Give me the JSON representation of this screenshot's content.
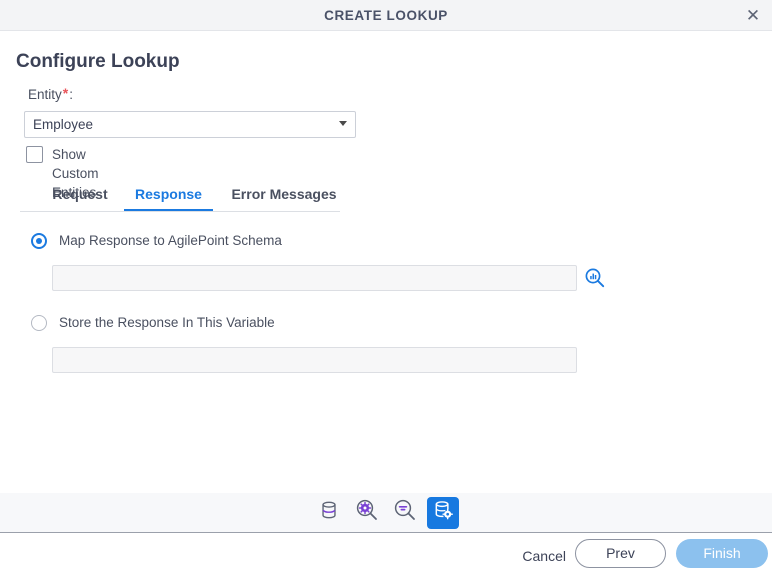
{
  "window": {
    "title": "CREATE LOOKUP",
    "close_icon": "close-icon",
    "close_glyph": "✕"
  },
  "form": {
    "heading": "Configure Lookup",
    "entity": {
      "label": "Entity",
      "required_marker": "*",
      "colon": ":",
      "selected": "Employee",
      "options": [
        "Employee"
      ]
    },
    "show_custom_entities": {
      "label": "Show Custom Entities",
      "checked": false
    }
  },
  "tabs": [
    {
      "label": "Request",
      "active": false
    },
    {
      "label": "Response",
      "active": true
    },
    {
      "label": "Error Messages",
      "active": false
    }
  ],
  "response_tab": {
    "option_map": {
      "label": "Map Response to AgilePoint Schema",
      "selected": true,
      "input_value": "",
      "input_placeholder": "",
      "lookup_icon": "schema-search-icon"
    },
    "option_store": {
      "label": "Store the Response In This Variable",
      "selected": false,
      "input_value": "",
      "input_placeholder": ""
    }
  },
  "toolbar": {
    "buttons": [
      {
        "name": "database-icon",
        "active": false
      },
      {
        "name": "search-gear-icon",
        "active": false
      },
      {
        "name": "search-filter-icon",
        "active": false
      },
      {
        "name": "database-config-icon",
        "active": true
      }
    ]
  },
  "footer": {
    "cancel_label": "Cancel",
    "prev_label": "Prev",
    "finish_label": "Finish"
  },
  "colors": {
    "accent": "#1b7ae0",
    "accent_active_button": "#1779e0",
    "finish_button": "#8cc1ee",
    "required_star": "#e8545a",
    "icon_purple": "#7a42d4",
    "icon_gray": "#5d6475",
    "titlebar_bg": "#f3f4f6",
    "toolbar_bg": "#f7f8fa",
    "input_bg": "#f7f7f8"
  }
}
